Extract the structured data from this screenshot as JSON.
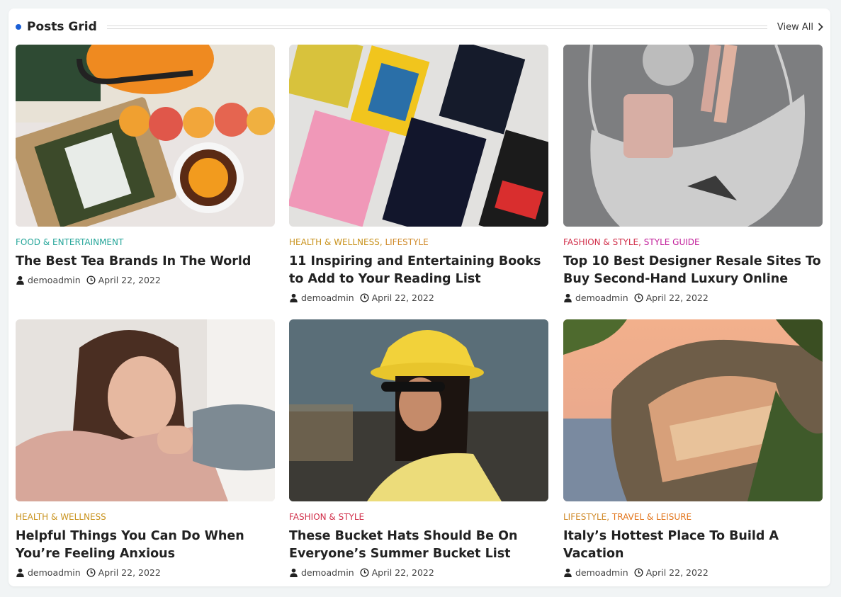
{
  "section": {
    "title": "Posts Grid",
    "view_all": "View All",
    "accent": "#1a5fd6"
  },
  "posts": [
    {
      "categories": [
        {
          "label": "FOOD & ENTERTAINMENT",
          "color": "#26a69a"
        }
      ],
      "title": "The Best Tea Brands In The World",
      "author": "demoadmin",
      "date": "April 22, 2022",
      "image": "tea-flatlay-image"
    },
    {
      "categories": [
        {
          "label": "HEALTH & WELLNESS",
          "color": "#c9931e"
        },
        {
          "label": "LIFESTYLE",
          "color": "#d08a2a"
        }
      ],
      "title": "11 Inspiring and Entertaining Books to Add to Your Reading List",
      "author": "demoadmin",
      "date": "April 22, 2022",
      "image": "books-flatlay-image"
    },
    {
      "categories": [
        {
          "label": "FASHION & STYLE",
          "color": "#d12f4a"
        },
        {
          "label": "STYLE GUIDE",
          "color": "#c2209b"
        }
      ],
      "title": "Top 10 Best Designer Resale Sites To Buy Second-Hand Luxury Online",
      "author": "demoadmin",
      "date": "April 22, 2022",
      "image": "designer-handbag-image"
    },
    {
      "categories": [
        {
          "label": "HEALTH & WELLNESS",
          "color": "#c9931e"
        }
      ],
      "title": "Helpful Things You Can Do When You’re Feeling Anxious",
      "author": "demoadmin",
      "date": "April 22, 2022",
      "image": "anxious-woman-image"
    },
    {
      "categories": [
        {
          "label": "FASHION & STYLE",
          "color": "#d12f4a"
        }
      ],
      "title": "These Bucket Hats Should Be On Everyone’s Summer Bucket List",
      "author": "demoadmin",
      "date": "April 22, 2022",
      "image": "yellow-bucket-hat-image"
    },
    {
      "categories": [
        {
          "label": "LIFESTYLE",
          "color": "#d08a2a"
        },
        {
          "label": "TRAVEL & LEISURE",
          "color": "#e2741a"
        }
      ],
      "title": "Italy’s Hottest Place To Build A Vacation",
      "author": "demoadmin",
      "date": "April 22, 2022",
      "image": "positano-coast-image"
    }
  ]
}
